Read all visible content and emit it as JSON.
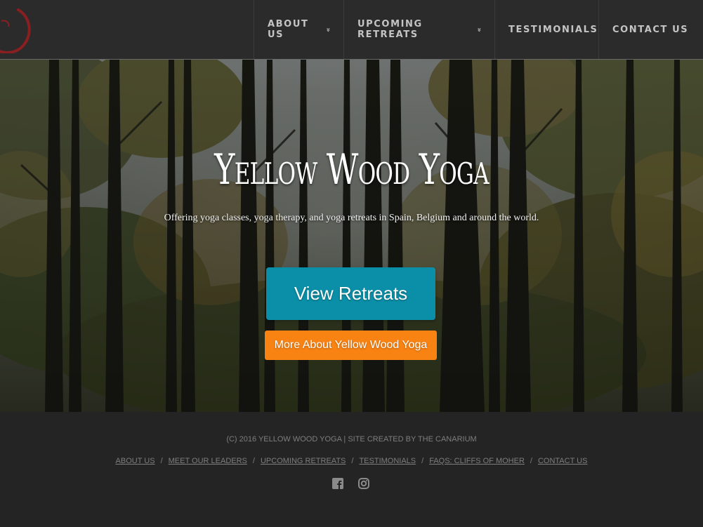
{
  "nav": {
    "items": [
      {
        "label": "ABOUT US",
        "has_dropdown": true
      },
      {
        "label": "UPCOMING RETREATS",
        "has_dropdown": true
      },
      {
        "label": "TESTIMONIALS",
        "has_dropdown": false
      },
      {
        "label": "CONTACT US",
        "has_dropdown": false
      }
    ],
    "dropdown_glyph": "»",
    "logo_icon": "enso-circle-icon"
  },
  "hero": {
    "title": "Yellow Wood Yoga",
    "subtitle": "Offering yoga classes, yoga therapy, and yoga retreats in Spain, Belgium and around the world.",
    "primary_button": "View Retreats",
    "secondary_button": "More About Yellow Wood Yoga",
    "background": "forest-photo"
  },
  "footer": {
    "copyright": "(C) 2016 YELLOW WOOD YOGA | SITE CREATED BY THE CANARIUM",
    "links": [
      "ABOUT US",
      "MEET OUR LEADERS",
      "UPCOMING RETREATS",
      "TESTIMONIALS",
      "FAQS: CLIFFS OF MOHER",
      "CONTACT US"
    ],
    "separator": "/",
    "social": [
      "facebook-icon",
      "instagram-icon"
    ]
  },
  "colors": {
    "nav_bg": "#2b2b2b",
    "primary_button": "#0b8fa8",
    "secondary_button": "#f88212",
    "footer_bg": "#242424",
    "logo": "#8a1f22"
  }
}
